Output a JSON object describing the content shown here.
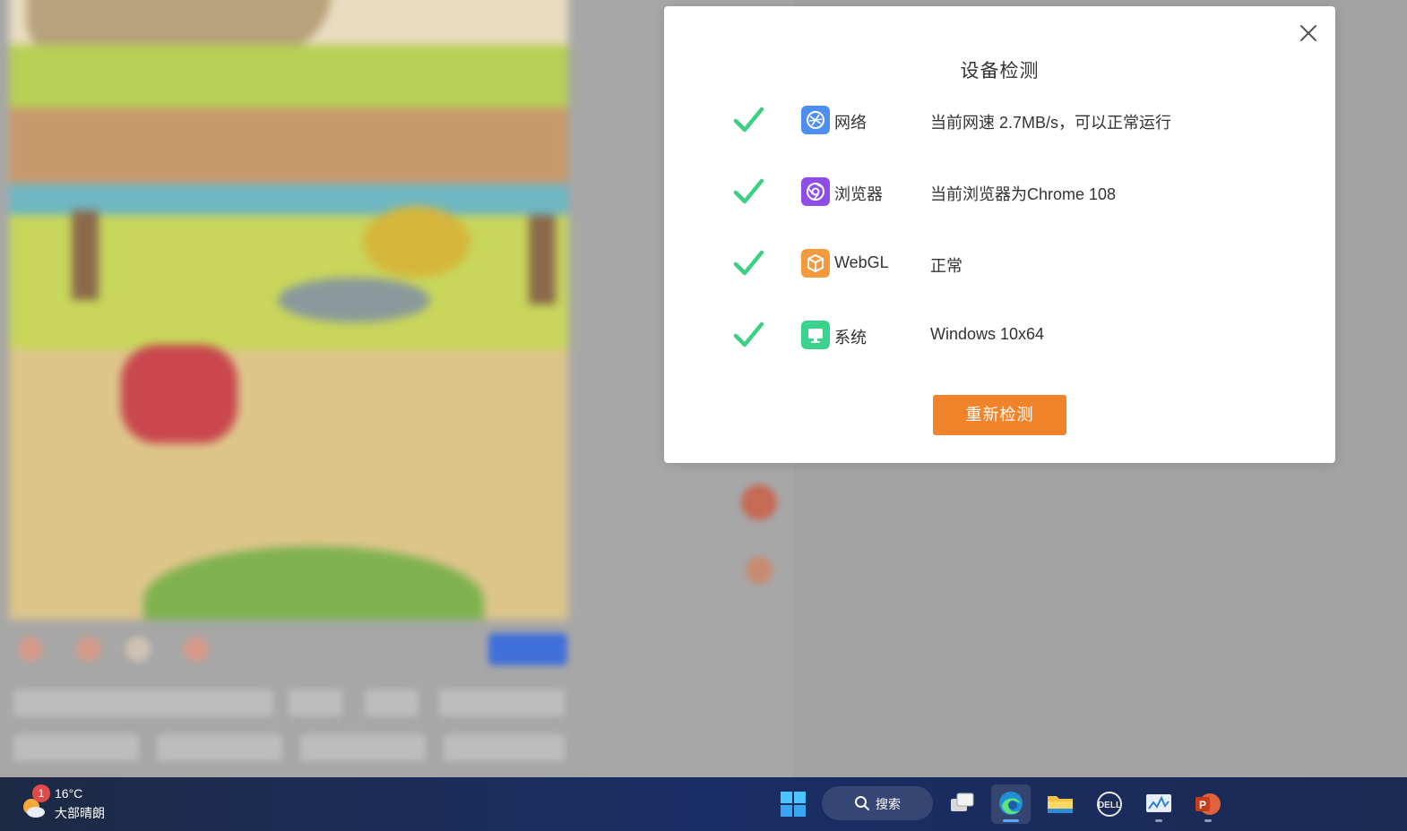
{
  "dialog": {
    "title": "设备检测",
    "close_icon": "close-icon",
    "items": [
      {
        "icon": "network-icon",
        "icon_color": "#4d8ef0",
        "label": "网络",
        "status": "当前网速 2.7MB/s，可以正常运行"
      },
      {
        "icon": "browser-icon",
        "icon_color": "#8f4de6",
        "label": "浏览器",
        "status": "当前浏览器为Chrome 108"
      },
      {
        "icon": "webgl-icon",
        "icon_color": "#f29a3d",
        "label": "WebGL",
        "status": "正常"
      },
      {
        "icon": "system-icon",
        "icon_color": "#3ad28c",
        "label": "系统",
        "status": "Windows 10x64"
      }
    ],
    "check_color": "#3dcf83",
    "recheck_button": "重新检测",
    "accent": "#f1842b"
  },
  "taskbar": {
    "weather": {
      "badge": "1",
      "temperature": "16°C",
      "description": "大部晴朗"
    },
    "search_label": "搜索",
    "apps": [
      "start-icon",
      "task-view-icon",
      "edge-icon",
      "file-explorer-icon",
      "dell-icon",
      "monitor-app-icon",
      "powerpoint-icon"
    ]
  }
}
